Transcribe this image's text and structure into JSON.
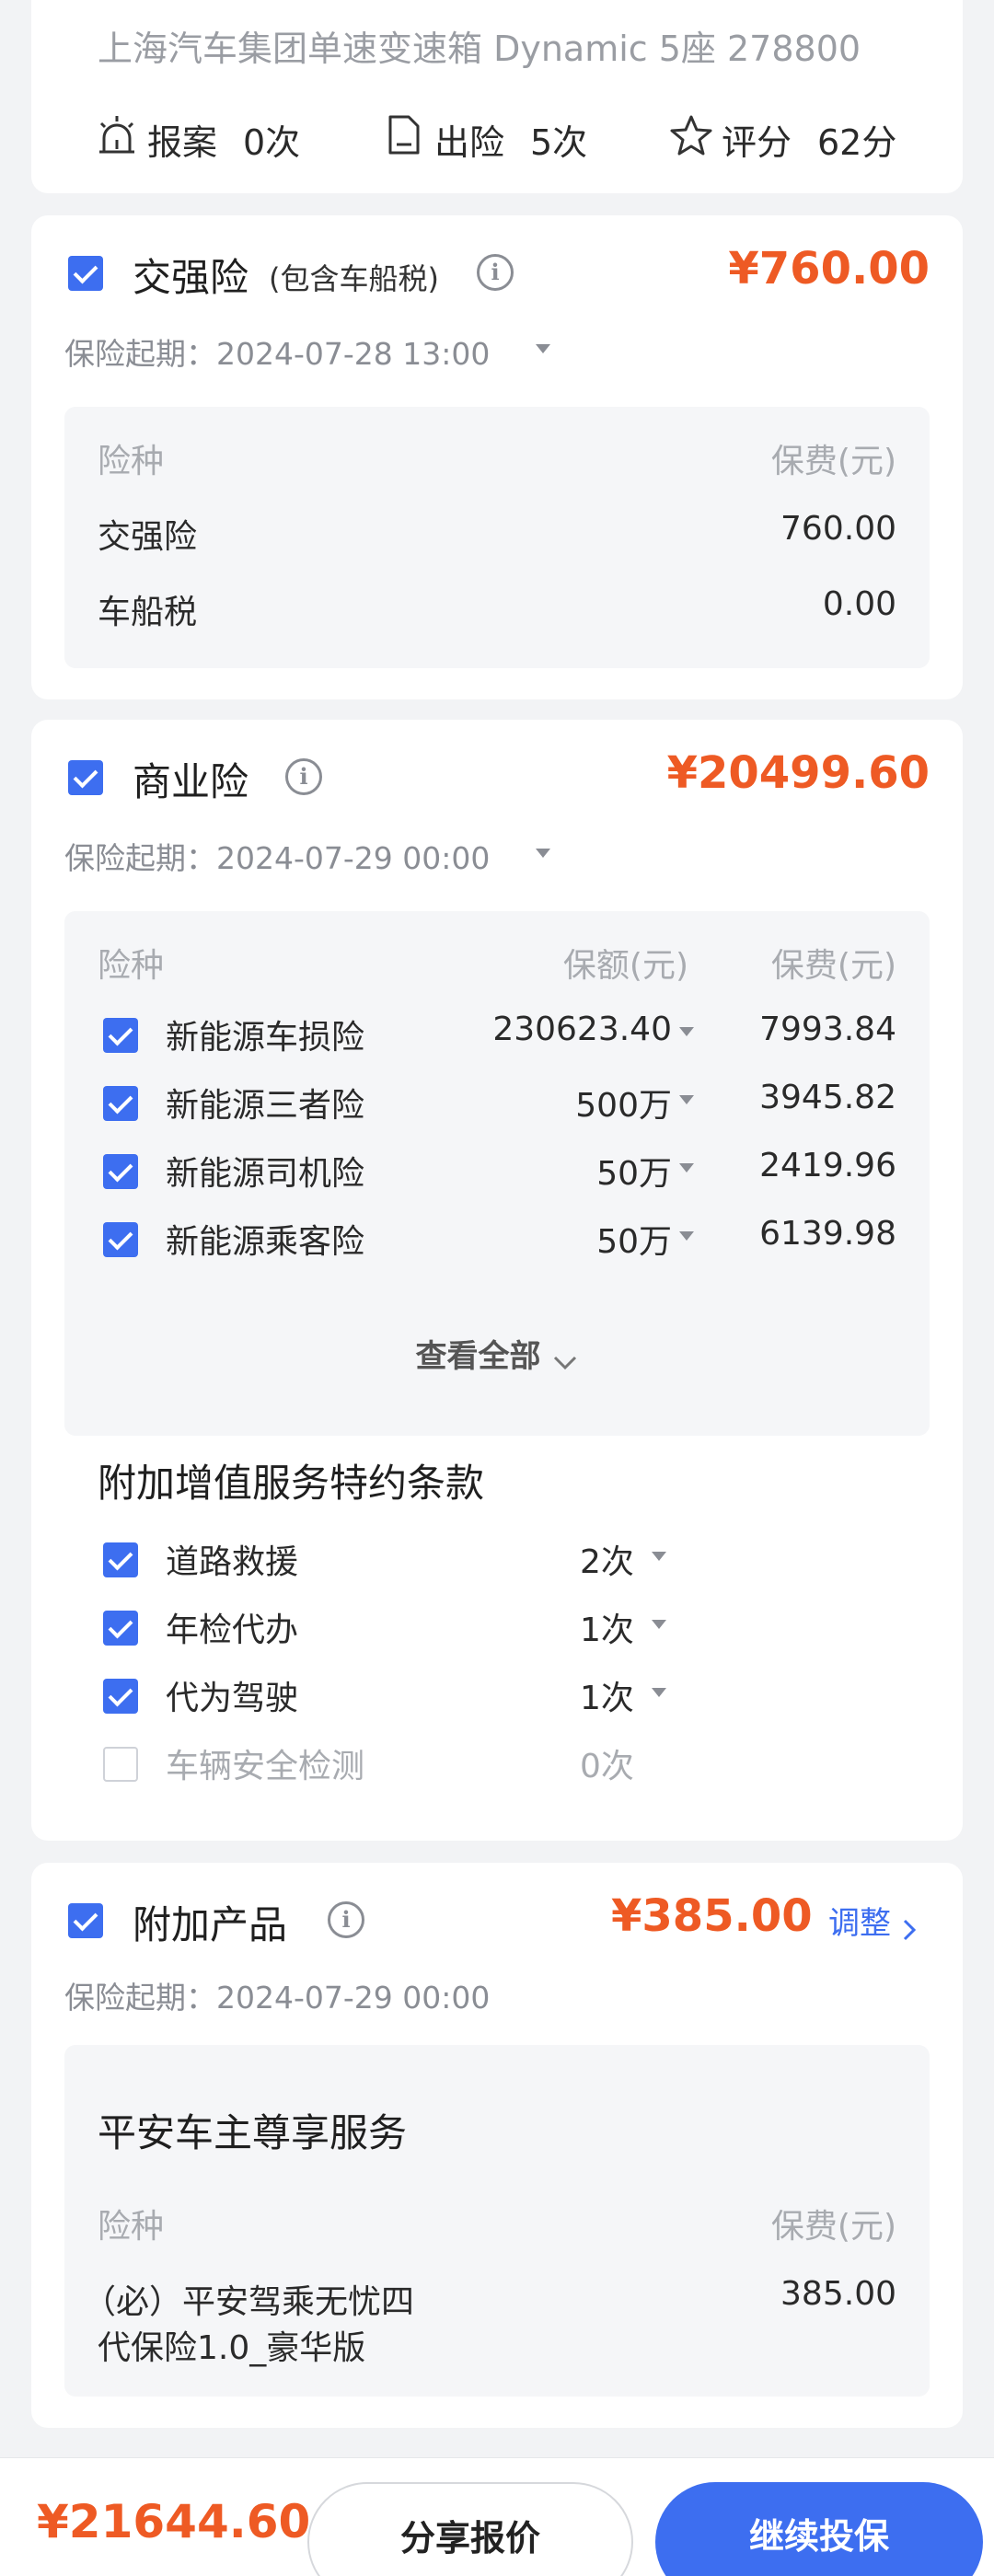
{
  "vehicle": {
    "model_line": "上海汽车集团单速变速箱 Dynamic 5座 278800",
    "stats": [
      {
        "icon": "siren-icon",
        "label": "报案",
        "value": "0次"
      },
      {
        "icon": "document-icon",
        "label": "出险",
        "value": "5次"
      },
      {
        "icon": "star-icon",
        "label": "评分",
        "value": "62分"
      }
    ]
  },
  "compulsory": {
    "title": "交强险",
    "subtitle": "(包含车船税)",
    "price": "¥760.00",
    "start": "保险起期：2024-07-28 13:00",
    "header_type": "险种",
    "header_fee": "保费(元)",
    "rows": [
      {
        "name": "交强险",
        "fee": "760.00"
      },
      {
        "name": "车船税",
        "fee": "0.00"
      }
    ]
  },
  "commercial": {
    "title": "商业险",
    "price": "¥20499.60",
    "start": "保险起期：2024-07-29 00:00",
    "header_type": "险种",
    "header_amount": "保额(元)",
    "header_fee": "保费(元)",
    "rows": [
      {
        "name": "新能源车损险",
        "amount": "230623.40",
        "fee": "7993.84"
      },
      {
        "name": "新能源三者险",
        "amount": "500万",
        "fee": "3945.82"
      },
      {
        "name": "新能源司机险",
        "amount": "50万",
        "fee": "2419.96"
      },
      {
        "name": "新能源乘客险",
        "amount": "50万",
        "fee": "6139.98"
      }
    ],
    "view_all": "查看全部",
    "addon_title": "附加增值服务特约条款",
    "addons": [
      {
        "name": "道路救援",
        "count": "2次",
        "checked": true
      },
      {
        "name": "年检代办",
        "count": "1次",
        "checked": true
      },
      {
        "name": "代为驾驶",
        "count": "1次",
        "checked": true
      },
      {
        "name": "车辆安全检测",
        "count": "0次",
        "checked": false
      }
    ]
  },
  "additional": {
    "title": "附加产品",
    "price": "¥385.00",
    "adjust": "调整",
    "start": "保险起期：2024-07-29 00:00",
    "service_title": "平安车主尊享服务",
    "header_type": "险种",
    "header_fee": "保费(元)",
    "item_line1": "（必）平安驾乘无忧四",
    "item_line2": "代保险1.0_豪华版",
    "item_fee": "385.00"
  },
  "footer": {
    "total": "¥21644.60",
    "share": "分享报价",
    "continue": "继续投保"
  },
  "colors": {
    "accent": "#3d6ef0",
    "price": "#ee5a24",
    "background": "#f2f3f5"
  }
}
